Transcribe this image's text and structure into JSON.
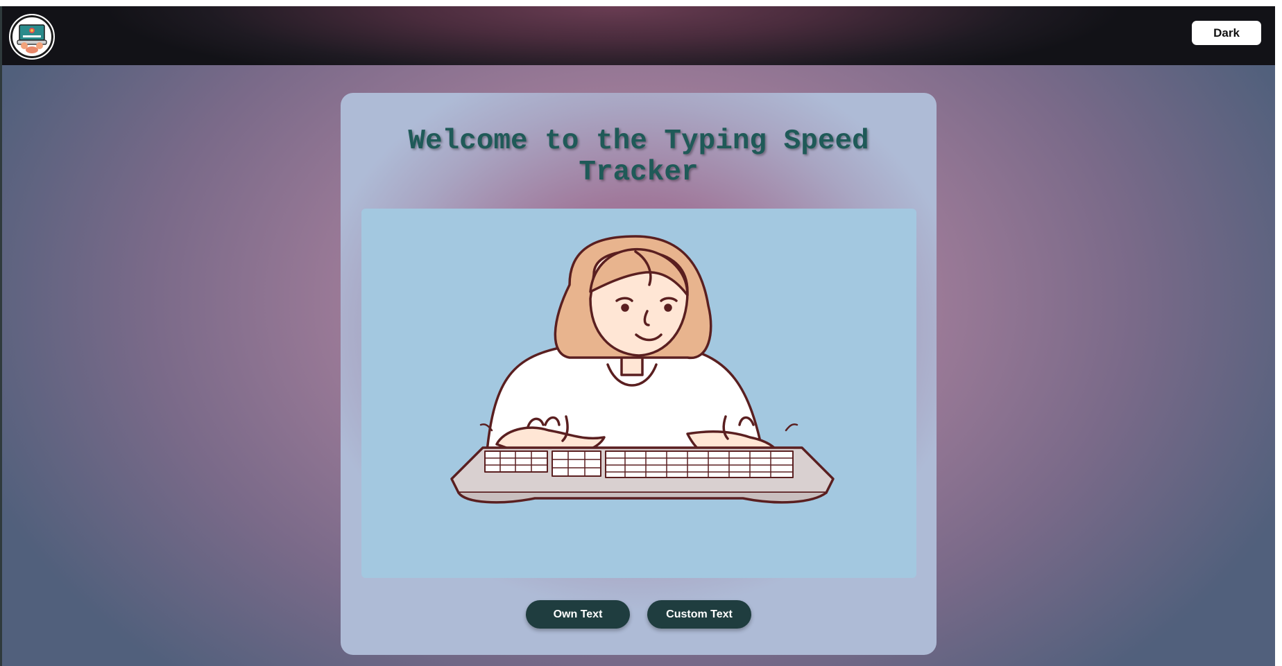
{
  "navbar": {
    "logo_alt": "Typing Speed Tracker logo",
    "theme_toggle_label": "Dark"
  },
  "main": {
    "title": "Welcome to the Typing Speed Tracker",
    "hero_icon": "person-typing-illustration",
    "buttons": {
      "own_text": "Own Text",
      "custom_text": "Custom Text"
    }
  },
  "colors": {
    "accent": "#1f3d3f",
    "title": "#1f5a58",
    "hero_background": "#a3c8e0"
  }
}
